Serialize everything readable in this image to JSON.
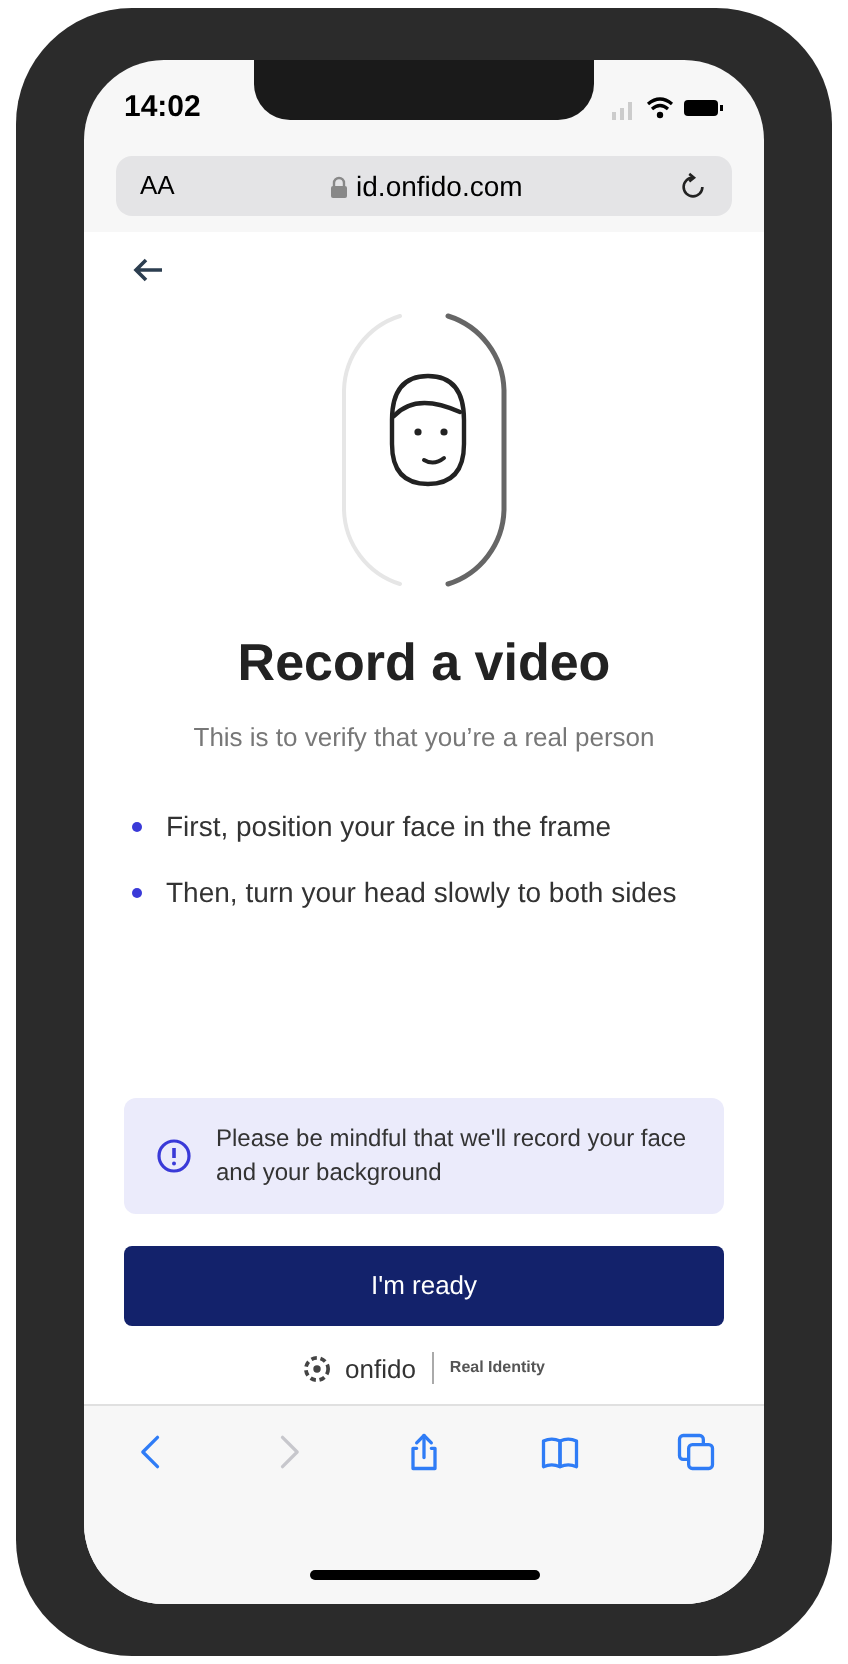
{
  "status_bar": {
    "time": "14:02"
  },
  "address_bar": {
    "text_size": "AA",
    "url": "id.onfido.com"
  },
  "page": {
    "title": "Record a video",
    "subtitle": "This is to verify that you’re a real person",
    "steps": [
      "First, position your face in the frame",
      "Then, turn your head slowly to both sides"
    ],
    "notice": "Please be mindful that we'll record your face and your background",
    "button": "I'm ready",
    "footer": {
      "brand": "onfido",
      "tagline": "Real Identity"
    }
  },
  "toolbar": [
    {
      "kind": "back",
      "disabled": false
    },
    {
      "kind": "forward",
      "disabled": true
    },
    {
      "kind": "share",
      "disabled": false
    },
    {
      "kind": "bookmarks",
      "disabled": false
    },
    {
      "kind": "tabs",
      "disabled": false
    }
  ]
}
